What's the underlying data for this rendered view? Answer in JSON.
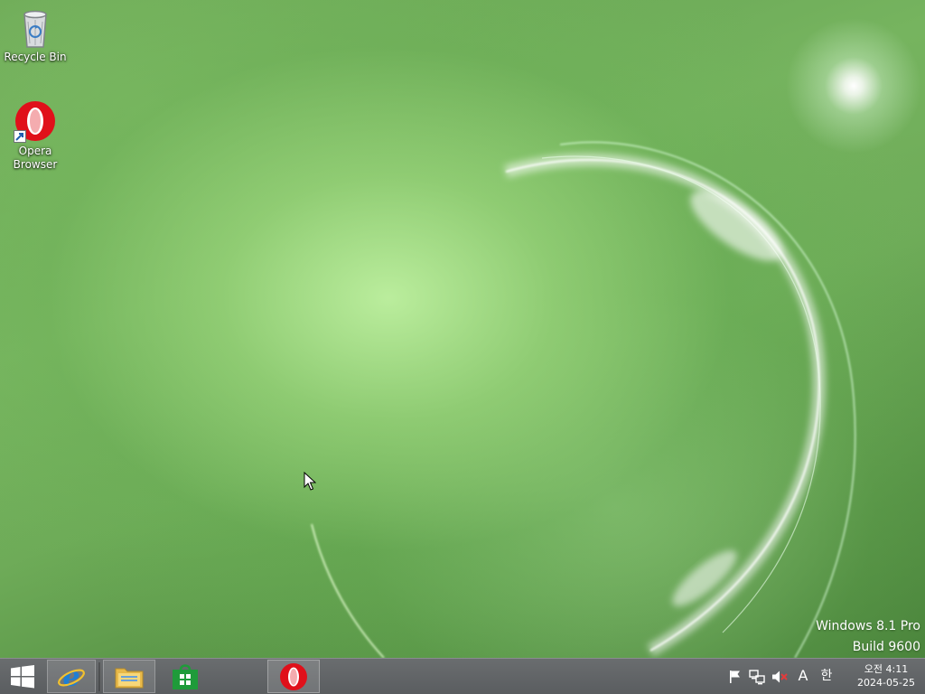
{
  "desktop": {
    "icons": [
      {
        "label": "Recycle Bin",
        "icon": "recycle-bin-icon"
      },
      {
        "label": "Opera\nBrowser",
        "label_line1": "Opera",
        "label_line2": "Browser",
        "icon": "opera-icon"
      }
    ],
    "watermark": {
      "line1": "Windows 8.1 Pro",
      "line2": "Build 9600"
    }
  },
  "taskbar": {
    "buttons": [
      {
        "name": "start",
        "icon": "windows-logo-icon"
      },
      {
        "name": "internet-explorer",
        "icon": "internet-explorer-icon"
      },
      {
        "name": "file-explorer",
        "icon": "folder-icon"
      },
      {
        "name": "store",
        "icon": "store-icon"
      },
      {
        "name": "opera",
        "icon": "opera-icon"
      }
    ],
    "tray": {
      "icons": [
        "flag-icon",
        "network-icon",
        "volume-muted-icon"
      ],
      "ime_mode": "A",
      "ime_lang": "한",
      "time": "오전 4:11",
      "date": "2024-05-25"
    }
  },
  "colors": {
    "taskbar": "#5f6264",
    "opera_red": "#e0101a",
    "store_green": "#1f9b3a",
    "ie_blue": "#1e7fd4"
  }
}
